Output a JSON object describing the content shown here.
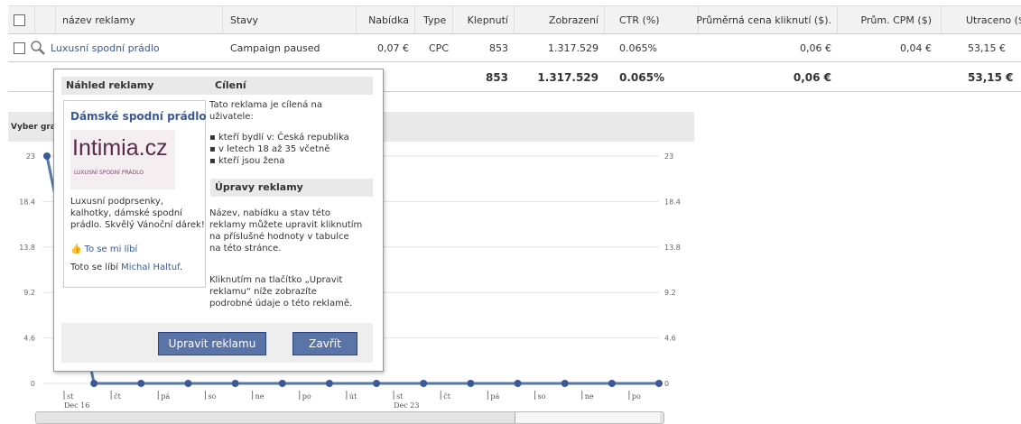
{
  "table": {
    "headers": [
      "název reklamy",
      "Stavy",
      "Nabídka",
      "Type",
      "Klepnutí",
      "Zobrazení",
      "CTR (%)",
      "Průměrná cena kliknutí ($).",
      "Prům. CPM ($)",
      "Utraceno ($"
    ],
    "row": {
      "name": "Luxusní spodní prádlo",
      "status": "Campaign paused",
      "bid": "0,07 €",
      "type": "CPC",
      "clicks": "853",
      "impressions": "1.317.529",
      "ctr": "0.065%",
      "avg_cpc": "0,06 €",
      "avg_cpm": "0,04 €",
      "spent": "53,15 €"
    },
    "total": {
      "clicks": "853",
      "impressions": "1.317.529",
      "ctr": "0.065%",
      "avg_cpc": "0,06 €",
      "spent": "53,15 €"
    }
  },
  "chart": {
    "selector_label": "Vyber gra",
    "y_ticks": [
      "23",
      "18.4",
      "13.8",
      "9.2",
      "4.6",
      "0"
    ],
    "x_days": [
      "st",
      "čt",
      "pá",
      "so",
      "ne",
      "po",
      "út",
      "st",
      "čt",
      "pá",
      "so",
      "ne",
      "po"
    ],
    "week_labels": [
      "Dec 16",
      "Dec 23"
    ]
  },
  "chart_data": {
    "type": "line",
    "x": [
      "st",
      "čt",
      "pá",
      "so",
      "ne",
      "po",
      "út",
      "st",
      "čt",
      "pá",
      "so",
      "ne",
      "po",
      "út"
    ],
    "values": [
      23,
      0,
      0,
      0,
      0,
      0,
      0,
      0,
      0,
      0,
      0,
      0,
      0,
      0
    ],
    "ylim": [
      0,
      23
    ]
  },
  "popup": {
    "preview_heading": "Náhled reklamy",
    "ad_title": "Dámské spodní prádlo",
    "logo_text": "Intimia.cz",
    "logo_sub": "LUXUSNÍ SPODNÍ PRÁDLO",
    "ad_body": "Luxusní podprsenky, kalhotky, dámské spodní prádlo. Skvělý Vánoční dárek!",
    "like_label": "To se mi líbí",
    "likes_prefix": "Toto se líbí",
    "likes_name": "Michal Haltuf",
    "likes_suffix": ".",
    "targeting_heading": "Cílení",
    "targeting_intro": "Tato reklama je cílená na uživatele:",
    "targeting_items": [
      "kteří bydlí v: Česká republika",
      "v letech 18 až 35 včetně",
      "kteří jsou žena"
    ],
    "edit_heading": "Úpravy reklamy",
    "edit_text1": "Název, nabídku a stav této reklamy můžete upravit kliknutím na příslušné hodnoty v tabulce na této stránce.",
    "edit_text2": "Kliknutím na tlačítko „Upravit reklamu“ níže zobrazíte podrobné údaje o této reklamě.",
    "edit_button": "Upravit reklamu",
    "close_button": "Zavřít"
  }
}
